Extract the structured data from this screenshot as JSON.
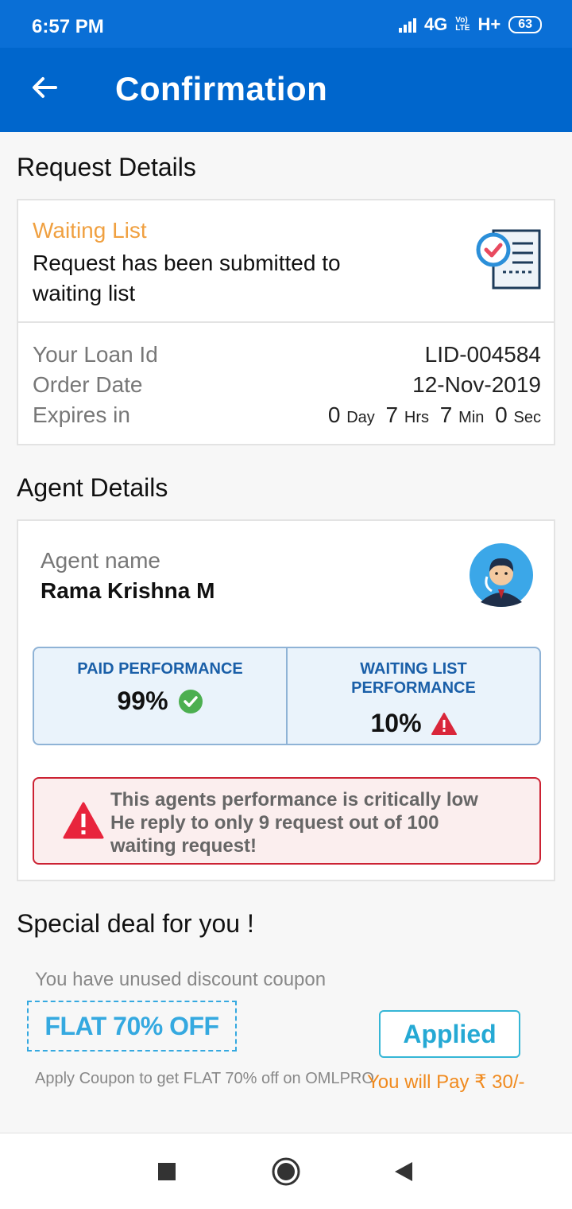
{
  "status_bar": {
    "time": "6:57 PM",
    "network": "4G",
    "volte_top": "Vo)",
    "volte_bottom": "LTE",
    "hplus": "H+",
    "battery": "63"
  },
  "app_bar": {
    "title": "Confirmation",
    "back_icon": "arrow-left-icon"
  },
  "request_details": {
    "section_title": "Request Details",
    "status_label": "Waiting List",
    "status_description": "Request has been submitted to waiting list",
    "status_icon": "checklist-document-icon",
    "rows": [
      {
        "label": "Your Loan Id",
        "value": "LID-004584"
      },
      {
        "label": "Order Date",
        "value": "12-Nov-2019"
      },
      {
        "label": "Expires in",
        "value": ""
      }
    ],
    "expires": {
      "day_value": "0",
      "day_unit": "Day",
      "hrs_value": "7",
      "hrs_unit": "Hrs",
      "min_value": "7",
      "min_unit": "Min",
      "sec_value": "0",
      "sec_unit": "Sec"
    }
  },
  "agent_details": {
    "section_title": "Agent Details",
    "agent_label": "Agent name",
    "agent_name": "Rama Krishna M",
    "avatar_icon": "agent-avatar-icon",
    "paid_performance": {
      "label": "PAID PERFORMANCE",
      "value": "99%",
      "icon": "check-circle-icon"
    },
    "waiting_performance": {
      "label_line1": "WAITING LIST",
      "label_line2": "PERFORMANCE",
      "value": "10%",
      "icon": "warning-triangle-icon"
    },
    "alert": {
      "icon": "warning-triangle-icon",
      "line1": "This agents performance is critically low",
      "line2": "He reply to only 9 request out of 100",
      "line3": "waiting request!"
    }
  },
  "special_deal": {
    "section_title": "Special deal for you !",
    "coupon_label": "You have unused discount coupon",
    "coupon_code": "FLAT 70% OFF",
    "applied_button": "Applied",
    "coupon_note": "Apply Coupon to get FLAT 70% off on OMLPRO",
    "pay_note": "You will Pay ₹ 30/-"
  },
  "nav_bar": {
    "recent_icon": "square-recent-icon",
    "home_icon": "circle-home-icon",
    "back_icon": "triangle-back-icon"
  },
  "colors": {
    "primary": "#0066cc",
    "status_bar": "#0a6fd6",
    "waiting_orange": "#f0a040",
    "coupon_blue": "#35a9e0",
    "alert_red": "#cc2233",
    "success_green": "#4caf50",
    "pay_orange": "#f08a1e"
  }
}
